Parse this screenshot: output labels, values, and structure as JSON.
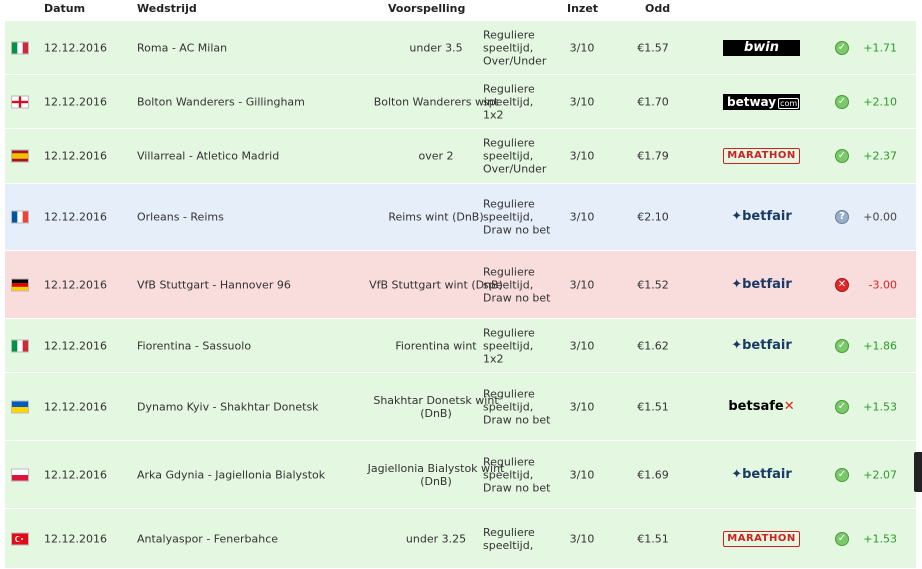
{
  "headers": {
    "datum": "Datum",
    "wedstrijd": "Wedstrijd",
    "voorspelling": "Voorspelling",
    "inzet": "Inzet",
    "odd": "Odd"
  },
  "colors": {
    "win_bg": "#e4f7e0",
    "void_bg": "#e6eef9",
    "loss_bg": "#f9dcdc",
    "profit_green": "#2c9a2c",
    "loss_red": "#dd2222"
  },
  "rows": [
    {
      "flag": "italy-flag",
      "date": "12.12.2016",
      "match": "Roma - AC Milan",
      "pred": "under 3.5",
      "type": "Reguliere speeltijd, Over/Under",
      "stake": "3/10",
      "odd": "€1.57",
      "book": "bwin",
      "book_label": "bwin",
      "status": "win",
      "status_icon": "✓",
      "profit": "+1.71"
    },
    {
      "flag": "england-flag",
      "date": "12.12.2016",
      "match": "Bolton Wanderers - Gillingham",
      "pred": "Bolton Wanderers wint",
      "type": "Reguliere speeltijd, 1x2",
      "stake": "3/10",
      "odd": "€1.70",
      "book": "betway",
      "book_label": "betway",
      "book_suffix": "com",
      "status": "win",
      "status_icon": "✓",
      "profit": "+2.10"
    },
    {
      "flag": "spain-flag",
      "date": "12.12.2016",
      "match": "Villarreal - Atletico Madrid",
      "pred": "over 2",
      "type": "Reguliere speeltijd, Over/Under",
      "stake": "3/10",
      "odd": "€1.79",
      "book": "marathon",
      "book_label": "MARATHON",
      "status": "win",
      "status_icon": "✓",
      "profit": "+2.37"
    },
    {
      "flag": "france-flag",
      "date": "12.12.2016",
      "match": "Orleans - Reims",
      "pred": "Reims wint (DnB)",
      "type": "Reguliere speeltijd, Draw no bet",
      "stake": "3/10",
      "odd": "€2.10",
      "book": "betfair",
      "book_label": "betfair",
      "status": "void",
      "status_icon": "?",
      "profit": "+0.00"
    },
    {
      "flag": "germany-flag",
      "date": "12.12.2016",
      "match": "VfB Stuttgart - Hannover 96",
      "pred": "VfB Stuttgart wint (DnB)",
      "type": "Reguliere speeltijd, Draw no bet",
      "stake": "3/10",
      "odd": "€1.52",
      "book": "betfair",
      "book_label": "betfair",
      "status": "loss",
      "status_icon": "✕",
      "profit": "-3.00"
    },
    {
      "flag": "italy-flag",
      "date": "12.12.2016",
      "match": "Fiorentina - Sassuolo",
      "pred": "Fiorentina wint",
      "type": "Reguliere speeltijd, 1x2",
      "stake": "3/10",
      "odd": "€1.62",
      "book": "betfair",
      "book_label": "betfair",
      "status": "win",
      "status_icon": "✓",
      "profit": "+1.86"
    },
    {
      "flag": "ukraine-flag",
      "date": "12.12.2016",
      "match": "Dynamo Kyiv - Shakhtar Donetsk",
      "pred": "Shakhtar Donetsk wint (DnB)",
      "type": "Reguliere speeltijd, Draw no bet",
      "stake": "3/10",
      "odd": "€1.51",
      "book": "betsafe",
      "book_label": "betsafe",
      "status": "win",
      "status_icon": "✓",
      "profit": "+1.53"
    },
    {
      "flag": "poland-flag",
      "date": "12.12.2016",
      "match": "Arka Gdynia - Jagiellonia Bialystok",
      "pred": "Jagiellonia Bialystok wint (DnB)",
      "type": "Reguliere speeltijd, Draw no bet",
      "stake": "3/10",
      "odd": "€1.69",
      "book": "betfair",
      "book_label": "betfair",
      "status": "win",
      "status_icon": "✓",
      "profit": "+2.07"
    },
    {
      "flag": "turkey-flag",
      "date": "12.12.2016",
      "match": "Antalyaspor - Fenerbahce",
      "pred": "under 3.25",
      "type": "Reguliere speeltijd,",
      "stake": "3/10",
      "odd": "€1.51",
      "book": "marathon",
      "book_label": "MARATHON",
      "status": "win",
      "status_icon": "✓",
      "profit": "+1.53"
    }
  ]
}
